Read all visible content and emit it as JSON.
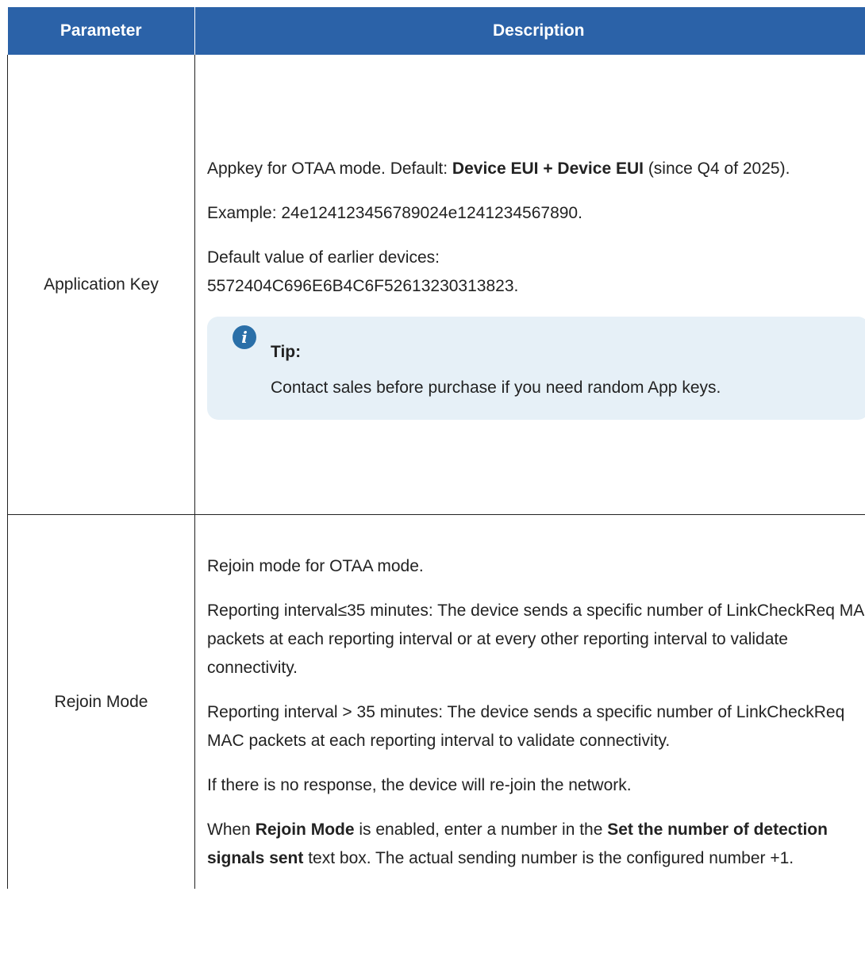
{
  "table": {
    "headers": {
      "parameter": "Parameter",
      "description": "Description"
    },
    "rows": [
      {
        "parameter": "Application Key",
        "p1": {
          "t1": "Appkey for OTAA mode. Default: ",
          "b1": "Device EUI + Device EUI",
          "t2": " (since Q4 of 2025)."
        },
        "p2": "Example: 24e124123456789024e1241234567890.",
        "p3": {
          "t1": "Default value of earlier devices:",
          "t2": "5572404C696E6B4C6F52613230313823."
        },
        "tip": {
          "icon": "info-icon",
          "icon_glyph": "i",
          "title": "Tip:",
          "body": "Contact sales before purchase if you need random App keys."
        }
      },
      {
        "parameter": "Rejoin Mode",
        "p1": "Rejoin mode for OTAA mode.",
        "p2": "Reporting interval≤35 minutes: The device sends a specific number of LinkCheckReq MAC packets at each reporting interval or at every other reporting interval to validate connectivity.",
        "p3": "Reporting interval > 35 minutes: The device sends a specific number of LinkCheckReq MAC packets at each reporting interval to validate connectivity.",
        "p4": "If there is no response, the device will re-join the network.",
        "p5": {
          "t1": "When ",
          "b1": "Rejoin Mode",
          "t2": " is enabled, enter a number in the ",
          "b2": "Set the number of detection signals sent",
          "t3": " text box. The actual sending number is the configured number +1."
        }
      }
    ]
  },
  "colors": {
    "header_bg": "#2b62a8",
    "tip_bg": "#e6f0f7",
    "tip_icon": "#2a6fa8"
  }
}
